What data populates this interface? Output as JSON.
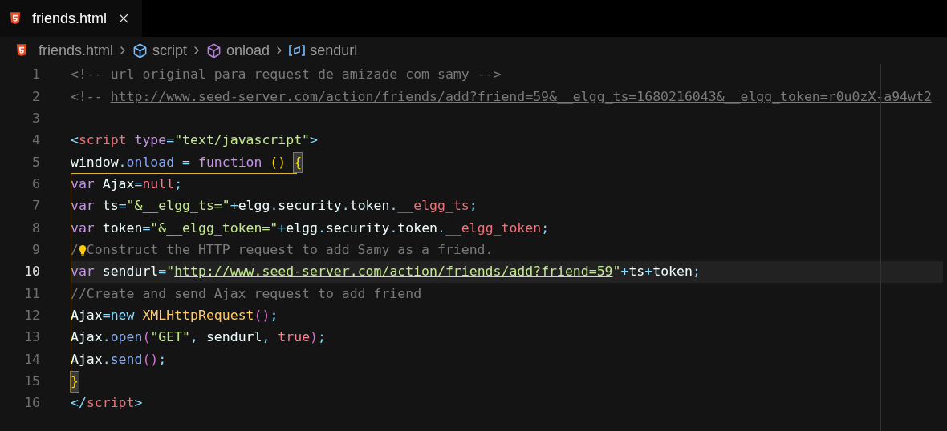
{
  "tab": {
    "title": "friends.html",
    "selected": true
  },
  "breadcrumbs": [
    {
      "label": "friends.html",
      "kind": "file"
    },
    {
      "label": "script",
      "kind": "module"
    },
    {
      "label": "onload",
      "kind": "method"
    },
    {
      "label": "sendurl",
      "kind": "variable"
    }
  ],
  "lines": [
    {
      "number": "1",
      "current": false,
      "lightbulb": false,
      "tokens": [
        {
          "text": "<!-- url original para request de amizade com samy -->",
          "kind": "comment"
        }
      ]
    },
    {
      "number": "2",
      "current": false,
      "lightbulb": false,
      "tokens": [
        {
          "text": "<!-- ",
          "kind": "comment"
        },
        {
          "text": "http://www.seed-server.com/action/friends/add?friend=59&__elgg_ts=1680216043&__elgg_token=r0u0zX-a94wt2",
          "kind": "comment-link"
        }
      ]
    },
    {
      "number": "3",
      "current": false,
      "lightbulb": false
    },
    {
      "number": "4",
      "current": false,
      "lightbulb": false,
      "tokens": [
        {
          "text": "<",
          "kind": "punct"
        },
        {
          "text": "script",
          "kind": "tag"
        },
        {
          "text": " type",
          "kind": "keyword"
        },
        {
          "text": "=",
          "kind": "punct"
        },
        {
          "text": "\"text/javascript\"",
          "kind": "string"
        },
        {
          "text": ">",
          "kind": "punct"
        }
      ]
    },
    {
      "number": "5",
      "current": false,
      "lightbulb": false,
      "tokens": [
        {
          "text": "window",
          "kind": "plain"
        },
        {
          "text": ".",
          "kind": "punct"
        },
        {
          "text": "onload",
          "kind": "method"
        },
        {
          "text": " =",
          "kind": "punct"
        },
        {
          "text": " function",
          "kind": "keyword"
        },
        {
          "text": " () ",
          "kind": "bracket1"
        },
        {
          "text": "{",
          "kind": "bracket-match"
        }
      ]
    },
    {
      "number": "6",
      "current": false,
      "lightbulb": false,
      "tokens": [
        {
          "text": "var",
          "kind": "keyword"
        },
        {
          "text": " Ajax",
          "kind": "plain"
        },
        {
          "text": "=",
          "kind": "punct"
        },
        {
          "text": "null",
          "kind": "constant"
        },
        {
          "text": ";",
          "kind": "punct"
        }
      ]
    },
    {
      "number": "7",
      "current": false,
      "lightbulb": false,
      "tokens": [
        {
          "text": "var",
          "kind": "keyword"
        },
        {
          "text": " ts",
          "kind": "plain"
        },
        {
          "text": "=",
          "kind": "punct"
        },
        {
          "text": "\"&__elgg_ts=\"",
          "kind": "string"
        },
        {
          "text": "+",
          "kind": "punct"
        },
        {
          "text": "elgg",
          "kind": "plain"
        },
        {
          "text": ".",
          "kind": "punct"
        },
        {
          "text": "security",
          "kind": "plain"
        },
        {
          "text": ".",
          "kind": "punct"
        },
        {
          "text": "token",
          "kind": "plain"
        },
        {
          "text": ".",
          "kind": "punct"
        },
        {
          "text": "__elgg_ts",
          "kind": "property"
        },
        {
          "text": ";",
          "kind": "punct"
        }
      ]
    },
    {
      "number": "8",
      "current": false,
      "lightbulb": false,
      "tokens": [
        {
          "text": "var",
          "kind": "keyword"
        },
        {
          "text": " token",
          "kind": "plain"
        },
        {
          "text": "=",
          "kind": "punct"
        },
        {
          "text": "\"&__elgg_token=\"",
          "kind": "string"
        },
        {
          "text": "+",
          "kind": "punct"
        },
        {
          "text": "elgg",
          "kind": "plain"
        },
        {
          "text": ".",
          "kind": "punct"
        },
        {
          "text": "security",
          "kind": "plain"
        },
        {
          "text": ".",
          "kind": "punct"
        },
        {
          "text": "token",
          "kind": "plain"
        },
        {
          "text": ".",
          "kind": "punct"
        },
        {
          "text": "__elgg_token",
          "kind": "property"
        },
        {
          "text": ";",
          "kind": "punct"
        }
      ]
    },
    {
      "number": "9",
      "current": false,
      "lightbulb": true,
      "tokens": [
        {
          "text": "/",
          "kind": "comment"
        },
        {
          "text": "Construct the HTTP request to add Samy as a friend.",
          "kind": "comment"
        }
      ]
    },
    {
      "number": "10",
      "current": true,
      "lightbulb": false,
      "tokens": [
        {
          "text": "var",
          "kind": "keyword"
        },
        {
          "text": " sendurl",
          "kind": "plain"
        },
        {
          "text": "=",
          "kind": "punct"
        },
        {
          "text": "\"",
          "kind": "string"
        },
        {
          "text": "http://www.seed-server.com/action/friends/add?friend=59",
          "kind": "string-link"
        },
        {
          "text": "\"",
          "kind": "string"
        },
        {
          "text": "+",
          "kind": "punct"
        },
        {
          "text": "ts",
          "kind": "plain"
        },
        {
          "text": "+",
          "kind": "punct"
        },
        {
          "text": "token",
          "kind": "plain"
        },
        {
          "text": ";",
          "kind": "punct"
        }
      ]
    },
    {
      "number": "11",
      "current": false,
      "lightbulb": false,
      "tokens": [
        {
          "text": "//Create and send Ajax request to add friend",
          "kind": "comment"
        }
      ]
    },
    {
      "number": "12",
      "current": false,
      "lightbulb": false,
      "tokens": [
        {
          "text": "Ajax",
          "kind": "plain"
        },
        {
          "text": "=",
          "kind": "punct"
        },
        {
          "text": "new",
          "kind": "operator"
        },
        {
          "text": " XMLHttpRequest",
          "kind": "class"
        },
        {
          "text": "()",
          "kind": "bracket2"
        },
        {
          "text": ";",
          "kind": "punct"
        }
      ]
    },
    {
      "number": "13",
      "current": false,
      "lightbulb": false,
      "tokens": [
        {
          "text": "Ajax",
          "kind": "plain"
        },
        {
          "text": ".",
          "kind": "punct"
        },
        {
          "text": "open",
          "kind": "method"
        },
        {
          "text": "(",
          "kind": "bracket2"
        },
        {
          "text": "\"GET\"",
          "kind": "string"
        },
        {
          "text": ",",
          "kind": "punct"
        },
        {
          "text": " sendurl",
          "kind": "plain"
        },
        {
          "text": ",",
          "kind": "punct"
        },
        {
          "text": " true",
          "kind": "constant"
        },
        {
          "text": ")",
          "kind": "bracket2"
        },
        {
          "text": ";",
          "kind": "punct"
        }
      ]
    },
    {
      "number": "14",
      "current": false,
      "lightbulb": false,
      "tokens": [
        {
          "text": "Ajax",
          "kind": "plain"
        },
        {
          "text": ".",
          "kind": "punct"
        },
        {
          "text": "send",
          "kind": "method"
        },
        {
          "text": "()",
          "kind": "bracket2"
        },
        {
          "text": ";",
          "kind": "punct"
        }
      ]
    },
    {
      "number": "15",
      "current": false,
      "lightbulb": false,
      "tokens": [
        {
          "text": "}",
          "kind": "bracket-match"
        }
      ]
    },
    {
      "number": "16",
      "current": false,
      "lightbulb": false,
      "tokens": [
        {
          "text": "</",
          "kind": "punct"
        },
        {
          "text": "script",
          "kind": "tag"
        },
        {
          "text": ">",
          "kind": "punct"
        }
      ]
    }
  ]
}
